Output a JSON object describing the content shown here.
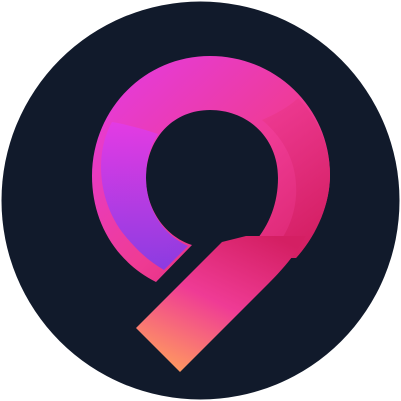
{
  "logo": {
    "icon_name": "nine-ribbon-logo-icon",
    "colors": {
      "background_circle": "#111a2b",
      "magenta": "#e33be8",
      "violet": "#7a3cf0",
      "pink": "#ef3b95",
      "crimson": "#d41f63",
      "orange": "#ff9c5e"
    }
  }
}
